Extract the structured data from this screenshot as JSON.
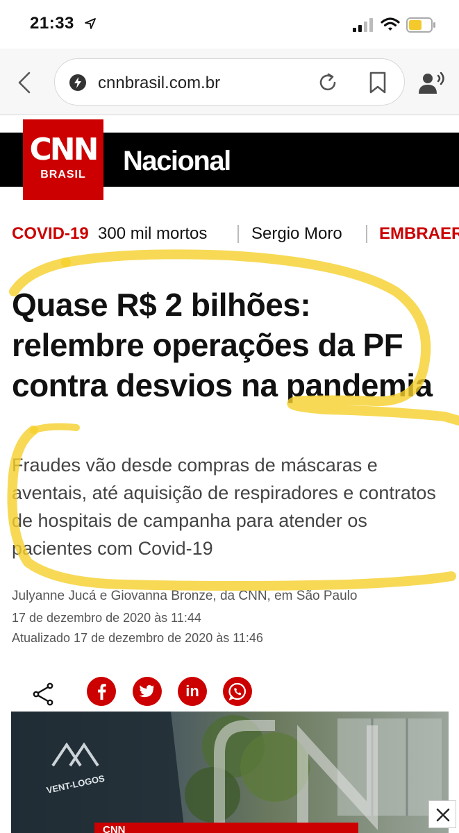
{
  "status_bar": {
    "time": "21:33"
  },
  "browser": {
    "url": "cnnbrasil.com.br"
  },
  "header": {
    "logo_text": "CNN",
    "logo_sub": "BRASIL",
    "section": "Nacional"
  },
  "topics": {
    "items": [
      "COVID-19",
      "300 mil mortos",
      "Sergio Moro",
      "EMBRAER"
    ]
  },
  "article": {
    "headline": "Quase R$ 2 bilhões: relembre operações da PF contra desvios na pandemia",
    "subtitle": "Fraudes vão desde compras de máscaras e aventais, até aquisição de respiradores e contratos de hospitais de campanha para atender os pacientes com Covid-19",
    "byline": "Julyanne Jucá e Giovanna Bronze, da CNN, em São Paulo",
    "published": "17 de dezembro de 2020 às 11:44",
    "updated": "Atualizado 17 de dezembro de 2020 às 11:46"
  },
  "share": {
    "facebook": "f",
    "twitter": "t",
    "linkedin": "in",
    "whatsapp": "w"
  },
  "image_text": {
    "vent_logos": "VENT-LOGOS",
    "banner": "CNN"
  },
  "colors": {
    "cnn_red": "#cc0000",
    "highlight": "#f5cf2a"
  },
  "icons": [
    "location-arrow-icon",
    "signal-icon",
    "wifi-icon",
    "battery-icon",
    "back-icon",
    "site-icon",
    "reload-icon",
    "bookmark-icon",
    "voice-icon",
    "share-icon",
    "facebook-icon",
    "twitter-icon",
    "linkedin-icon",
    "whatsapp-icon",
    "close-icon"
  ]
}
